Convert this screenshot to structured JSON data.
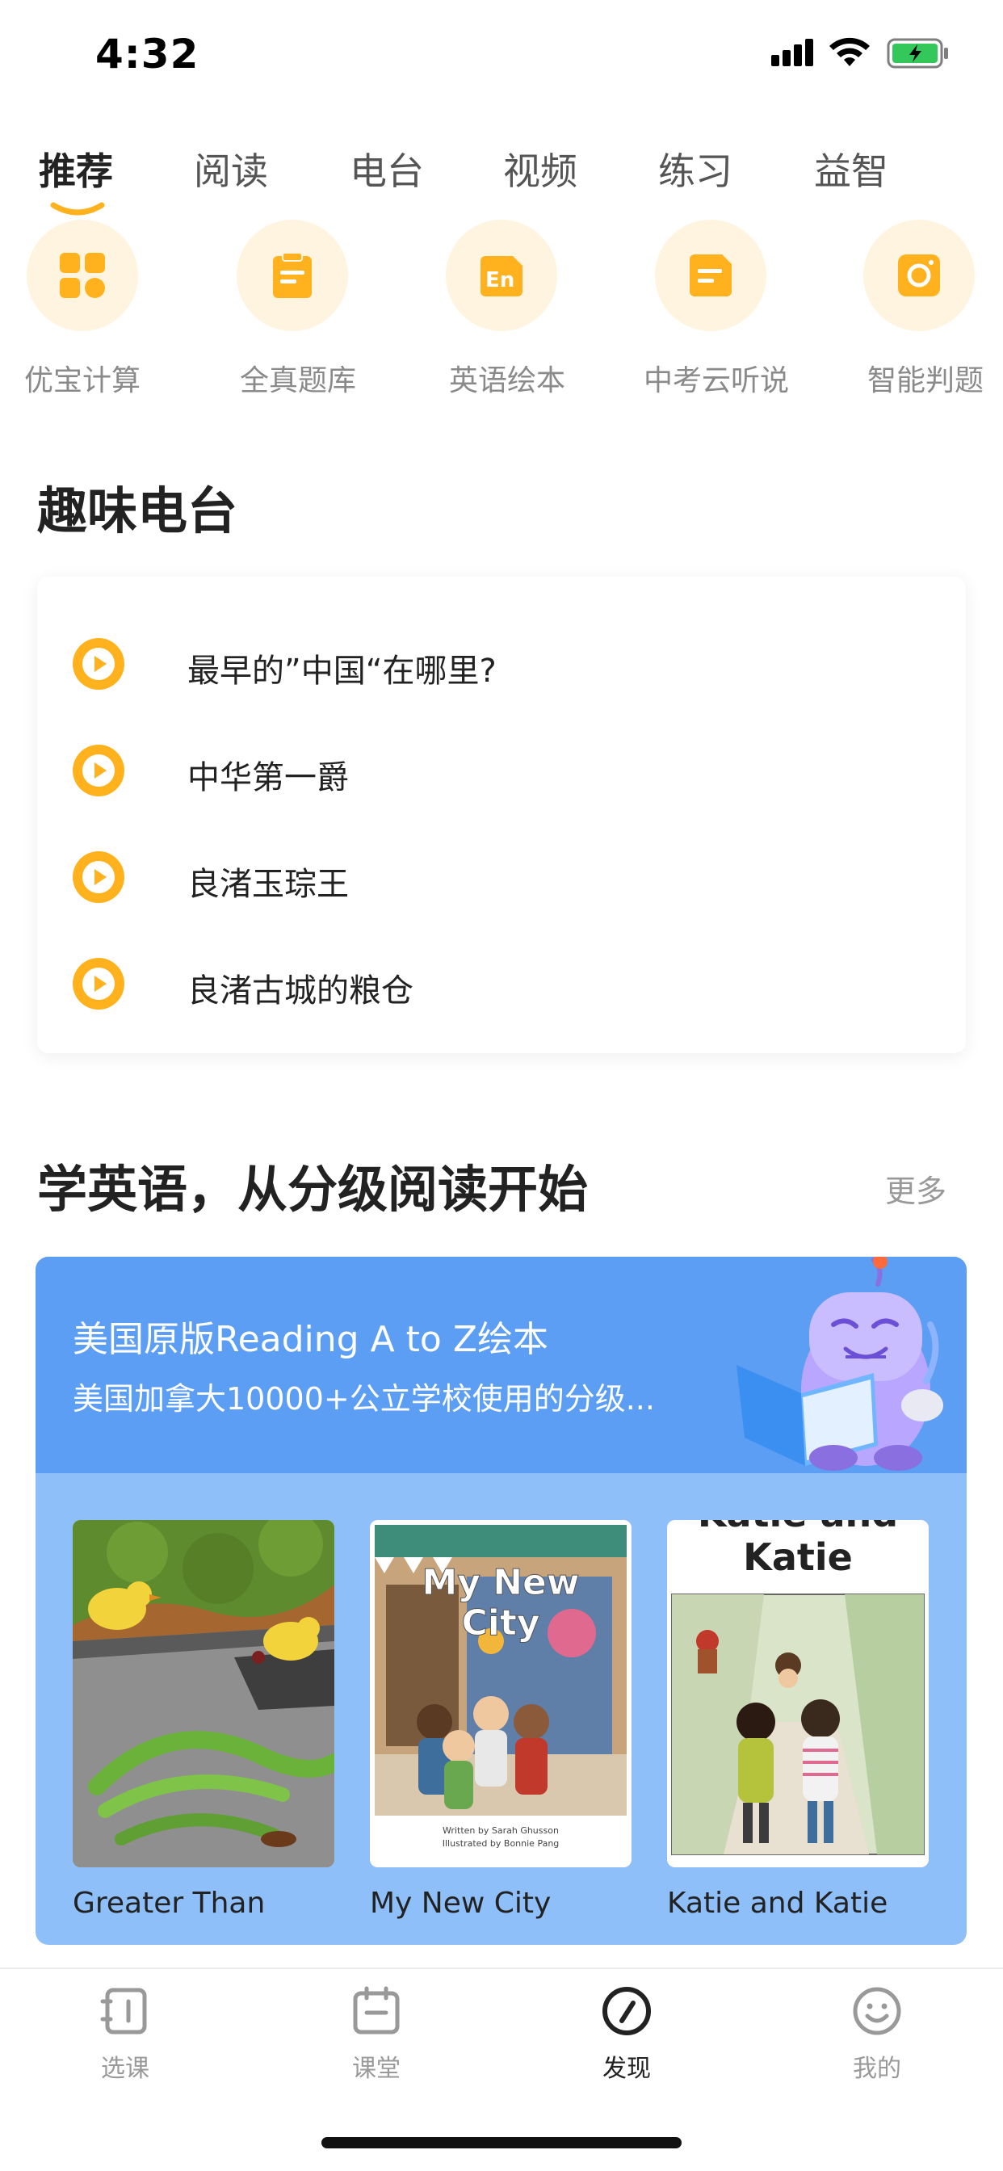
{
  "status_bar": {
    "time": "4:32"
  },
  "top_tabs": [
    {
      "label": "推荐",
      "active": true
    },
    {
      "label": "阅读",
      "active": false
    },
    {
      "label": "电台",
      "active": false
    },
    {
      "label": "视频",
      "active": false
    },
    {
      "label": "练习",
      "active": false
    },
    {
      "label": "益智",
      "active": false
    }
  ],
  "quick_entries": [
    {
      "label": "优宝计算",
      "icon": "grid-icon"
    },
    {
      "label": "全真题库",
      "icon": "clipboard-icon"
    },
    {
      "label": "英语绘本",
      "icon": "english-book-icon"
    },
    {
      "label": "中考云听说",
      "icon": "document-icon"
    },
    {
      "label": "智能判题",
      "icon": "camera-icon"
    }
  ],
  "radio_section": {
    "title": "趣味电台",
    "items": [
      "最早的”中国“在哪里?",
      "中华第一爵",
      "良渚玉琮王",
      "良渚古城的粮仓"
    ]
  },
  "reading_section": {
    "title": "学英语，从分级阅读开始",
    "more_label": "更多",
    "banner_title": "美国原版Reading A to Z绘本",
    "banner_subtitle": "美国加拿大10000+公立学校使用的分级...",
    "books": [
      {
        "title": "Greater Than"
      },
      {
        "title": "My New City",
        "cover_title_line1": "My New",
        "cover_title_line2": "City",
        "cover_credit_line1": "Written by Sarah Ghusson",
        "cover_credit_line2": "Illustrated by Bonnie Pang"
      },
      {
        "title": "Katie and Katie",
        "cover_title_line1": "Katie and",
        "cover_title_line2": "Katie"
      }
    ]
  },
  "bottom_nav": [
    {
      "label": "选课",
      "icon": "course-icon",
      "active": false
    },
    {
      "label": "课堂",
      "icon": "calendar-icon",
      "active": false
    },
    {
      "label": "发现",
      "icon": "compass-icon",
      "active": true
    },
    {
      "label": "我的",
      "icon": "smile-icon",
      "active": false
    }
  ],
  "colors": {
    "accent_orange": "#ffb21e",
    "light_orange": "#fff4df",
    "banner_blue": "#5b9ef4",
    "card_blue": "#8ebff9"
  }
}
